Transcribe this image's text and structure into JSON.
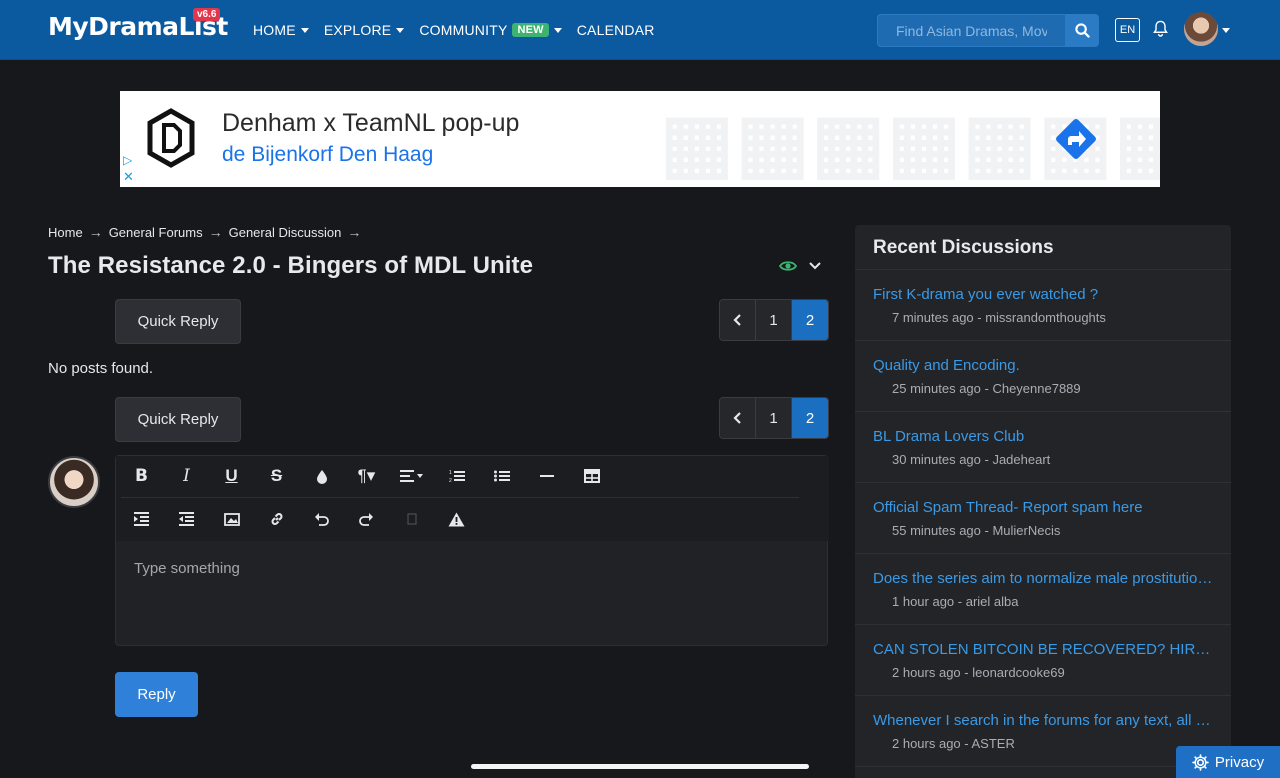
{
  "header": {
    "logo": "MyDramaList",
    "version": "v6.6",
    "nav": [
      {
        "label": "HOME"
      },
      {
        "label": "EXPLORE"
      },
      {
        "label": "COMMUNITY",
        "badge": "NEW"
      },
      {
        "label": "CALENDAR"
      }
    ],
    "search_placeholder": "Find Asian Dramas, Movies...",
    "lang": "EN"
  },
  "ad": {
    "title": "Denham x TeamNL pop-up",
    "subtitle": "de Bijenkorf Den Haag"
  },
  "breadcrumb": [
    "Home",
    "General Forums",
    "General Discussion"
  ],
  "thread": {
    "title": "The Resistance 2.0 - Bingers of MDL Unite",
    "quick_reply": "Quick Reply",
    "no_posts": "No posts found.",
    "pages": [
      "1",
      "2"
    ],
    "editor_placeholder": "Type something",
    "reply_button": "Reply"
  },
  "sidebar": {
    "title": "Recent Discussions",
    "items": [
      {
        "title": "First K-drama you ever watched ?",
        "meta": "7 minutes ago - missrandomthoughts"
      },
      {
        "title": "Quality and Encoding.",
        "meta": "25 minutes ago - Cheyenne7889"
      },
      {
        "title": "BL Drama Lovers Club",
        "meta": "30 minutes ago - Jadeheart"
      },
      {
        "title": "Official Spam Thread- Report spam here",
        "meta": "55 minutes ago - MulierNecis"
      },
      {
        "title": "Does the series aim to normalize male prostitution...",
        "meta": "1 hour ago - ariel alba"
      },
      {
        "title": "CAN STOLEN BITCOIN BE RECOVERED? HIRE R...",
        "meta": "2 hours ago - leonardcooke69"
      },
      {
        "title": "Whenever I search in the forums for any text, all of...",
        "meta": "2 hours ago - ASTER"
      }
    ]
  },
  "privacy": "Privacy",
  "colors": {
    "header": "#0b5aa0",
    "accent": "#1b6fc0",
    "link": "#3a9ae6",
    "badge_new": "#3cb371",
    "version": "#e0374d"
  }
}
